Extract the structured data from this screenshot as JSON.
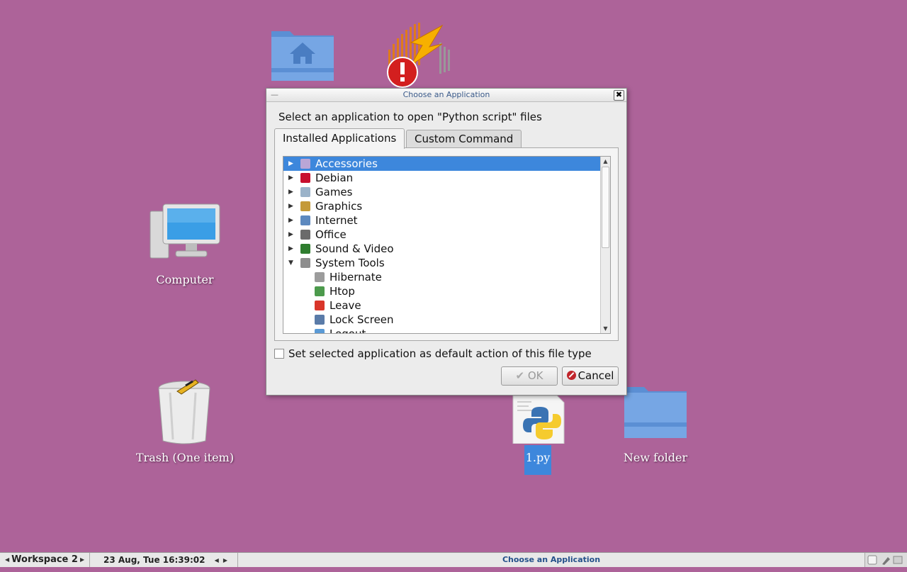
{
  "desktop": {
    "icons": [
      {
        "name": "home-folder",
        "label": ""
      },
      {
        "name": "error-app",
        "label": ""
      },
      {
        "name": "computer",
        "label": "Computer"
      },
      {
        "name": "trash",
        "label": "Trash (One item)"
      },
      {
        "name": "python-file",
        "label": "1.py"
      },
      {
        "name": "new-folder",
        "label": "New folder"
      }
    ]
  },
  "dialog": {
    "title": "Choose an Application",
    "minimize": "—",
    "close": "✖",
    "prompt": "Select an application to open \"Python script\" files",
    "tabs": [
      "Installed Applications",
      "Custom Command"
    ],
    "tree": [
      {
        "label": "Accessories",
        "icon": "accessories-icon",
        "expander": "▶",
        "level": 0,
        "selected": true
      },
      {
        "label": "Debian",
        "icon": "debian-icon",
        "expander": "▶",
        "level": 0
      },
      {
        "label": "Games",
        "icon": "games-icon",
        "expander": "▶",
        "level": 0
      },
      {
        "label": "Graphics",
        "icon": "graphics-icon",
        "expander": "▶",
        "level": 0
      },
      {
        "label": "Internet",
        "icon": "internet-icon",
        "expander": "▶",
        "level": 0
      },
      {
        "label": "Office",
        "icon": "office-icon",
        "expander": "▶",
        "level": 0
      },
      {
        "label": "Sound & Video",
        "icon": "sound-video-icon",
        "expander": "▶",
        "level": 0
      },
      {
        "label": "System Tools",
        "icon": "system-tools-icon",
        "expander": "▼",
        "level": 0
      },
      {
        "label": "Hibernate",
        "icon": "hibernate-icon",
        "expander": "",
        "level": 1
      },
      {
        "label": "Htop",
        "icon": "htop-icon",
        "expander": "",
        "level": 1
      },
      {
        "label": "Leave",
        "icon": "leave-icon",
        "expander": "",
        "level": 1
      },
      {
        "label": "Lock Screen",
        "icon": "lock-screen-icon",
        "expander": "",
        "level": 1
      },
      {
        "label": "Logout",
        "icon": "logout-icon",
        "expander": "",
        "level": 1
      }
    ],
    "default_checkbox_label": "Set selected application as default action of this file type",
    "ok_label": "OK",
    "cancel_label": "Cancel"
  },
  "taskbar": {
    "workspace": "Workspace 2",
    "clock": "23 Aug, Tue 16:39:02",
    "active_task": "Choose an Application"
  },
  "colors": {
    "desktop": "#ad6399",
    "selection": "#3d87dc"
  }
}
